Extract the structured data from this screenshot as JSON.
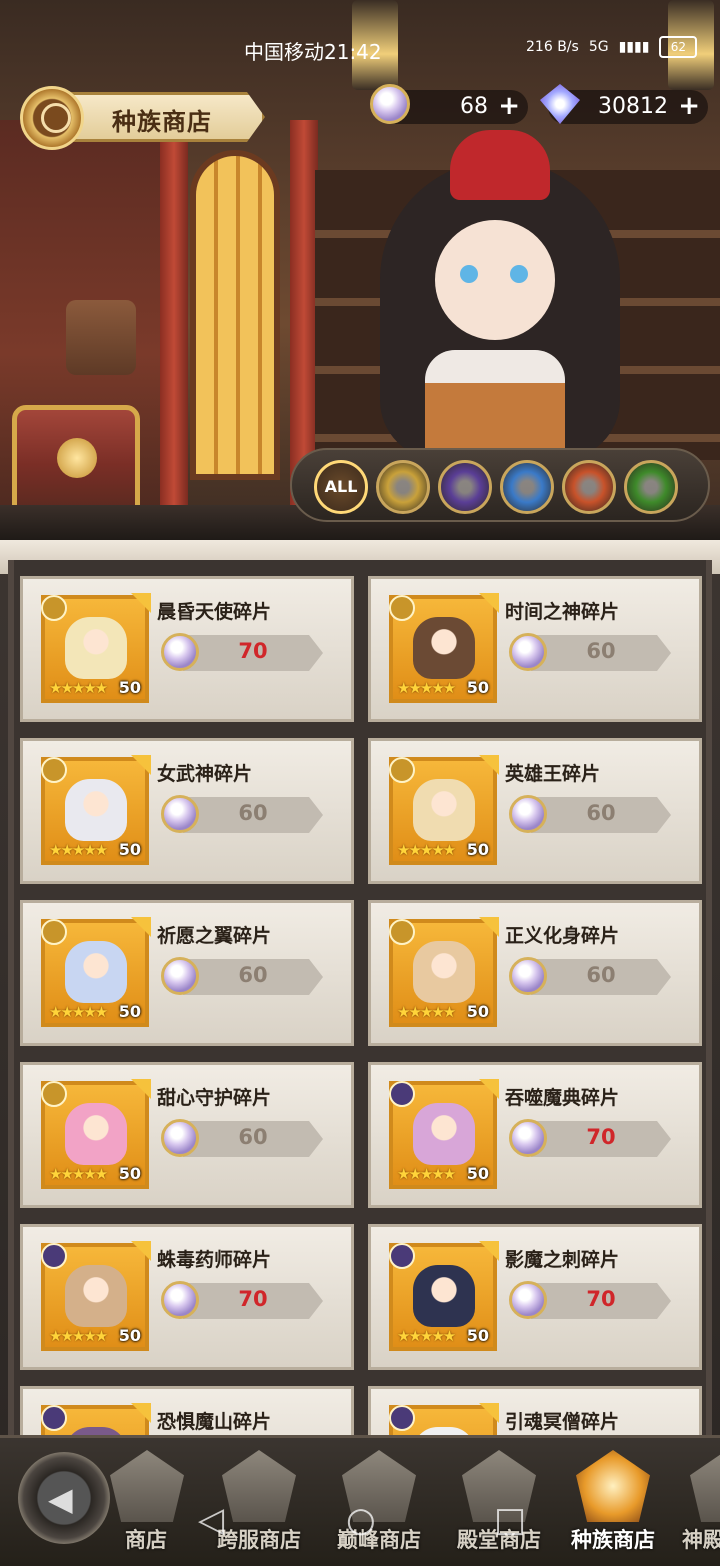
{
  "status_bar": {
    "carrier_time": "中国移动21:42",
    "speed_top": "216",
    "speed_unit": "B/s",
    "network": "5G",
    "battery": "62"
  },
  "header": {
    "shop_title": "种族商店"
  },
  "currency": {
    "pearls": "68",
    "gems": "30812"
  },
  "filters": [
    {
      "label": "ALL",
      "icon": "all-icon"
    },
    {
      "label": "",
      "icon": "light-faction-icon",
      "color": "#c9a13a"
    },
    {
      "label": "",
      "icon": "dark-faction-icon",
      "color": "#5a3e96"
    },
    {
      "label": "",
      "icon": "sword-faction-icon",
      "color": "#3a7ac8"
    },
    {
      "label": "",
      "icon": "wolf-faction-icon",
      "color": "#c8522a"
    },
    {
      "label": "",
      "icon": "tree-faction-icon",
      "color": "#3e8a2a"
    }
  ],
  "items": [
    {
      "name": "晨昏天使碎片",
      "price": "70",
      "level": "50",
      "stars": "★★★★★",
      "price_color": "red",
      "faction": "light"
    },
    {
      "name": "时间之神碎片",
      "price": "60",
      "level": "50",
      "stars": "★★★★★",
      "price_color": "gray",
      "faction": "light"
    },
    {
      "name": "女武神碎片",
      "price": "60",
      "level": "50",
      "stars": "★★★★★",
      "price_color": "gray",
      "faction": "light"
    },
    {
      "name": "英雄王碎片",
      "price": "60",
      "level": "50",
      "stars": "★★★★★",
      "price_color": "gray",
      "faction": "light"
    },
    {
      "name": "祈愿之翼碎片",
      "price": "60",
      "level": "50",
      "stars": "★★★★★",
      "price_color": "gray",
      "faction": "light"
    },
    {
      "name": "正义化身碎片",
      "price": "60",
      "level": "50",
      "stars": "★★★★★",
      "price_color": "gray",
      "faction": "light"
    },
    {
      "name": "甜心守护碎片",
      "price": "60",
      "level": "50",
      "stars": "★★★★★",
      "price_color": "gray",
      "faction": "light"
    },
    {
      "name": "吞噬魔典碎片",
      "price": "70",
      "level": "50",
      "stars": "★★★★★",
      "price_color": "red",
      "faction": "dark"
    },
    {
      "name": "蛛毒药师碎片",
      "price": "70",
      "level": "50",
      "stars": "★★★★★",
      "price_color": "red",
      "faction": "dark"
    },
    {
      "name": "影魔之刺碎片",
      "price": "70",
      "level": "50",
      "stars": "★★★★★",
      "price_color": "red",
      "faction": "dark"
    },
    {
      "name": "恐惧魔山碎片",
      "price": "",
      "level": "",
      "stars": "",
      "price_color": "red",
      "faction": "dark"
    },
    {
      "name": "引魂冥僧碎片",
      "price": "",
      "level": "",
      "stars": "",
      "price_color": "red",
      "faction": "dark"
    }
  ],
  "nav": {
    "tabs": [
      {
        "label": "商店",
        "icon": "shop-icon"
      },
      {
        "label": "跨服商店",
        "icon": "crossserver-shop-icon"
      },
      {
        "label": "巅峰商店",
        "icon": "peak-shop-icon"
      },
      {
        "label": "殿堂商店",
        "icon": "hall-shop-icon"
      },
      {
        "label": "种族商店",
        "icon": "race-shop-icon"
      },
      {
        "label": "神殿",
        "icon": "temple-shop-icon"
      }
    ],
    "active": 4
  },
  "colors": {
    "accent_gold": "#d6a94a",
    "price_red": "#d0262a",
    "price_gray": "#8c7f72",
    "portrait_orange": "#f0a52a"
  }
}
